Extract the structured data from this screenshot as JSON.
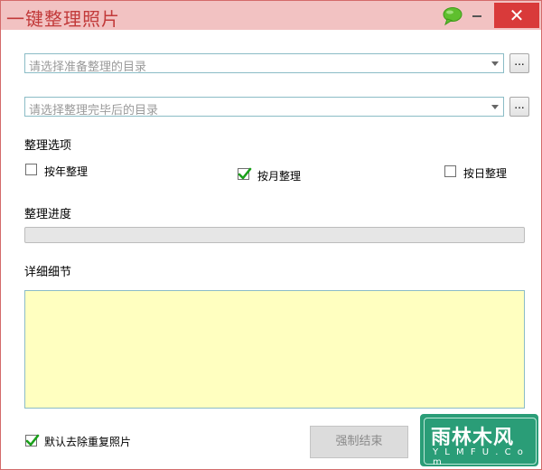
{
  "window": {
    "title": "一键整理照片",
    "close_glyph": "✕"
  },
  "icons": {
    "chat": "chat-bubble-icon",
    "minimize": "minimize-icon",
    "close": "close-icon",
    "dropdown_arrow": "chevron-down-icon",
    "check": "checkmark-icon"
  },
  "source_dir": {
    "placeholder": "请选择准备整理的目录",
    "browse_label": "..."
  },
  "target_dir": {
    "placeholder": "请选择整理完毕后的目录",
    "browse_label": "..."
  },
  "options": {
    "heading": "整理选项",
    "items": [
      {
        "label": "按年整理",
        "checked": false
      },
      {
        "label": "按月整理",
        "checked": true
      },
      {
        "label": "按日整理",
        "checked": false
      }
    ]
  },
  "progress": {
    "heading": "整理进度",
    "value": 0
  },
  "details": {
    "heading": "详细细节",
    "content": ""
  },
  "footer": {
    "dedupe_label": "默认去除重复照片",
    "dedupe_checked": true,
    "stop_button": "强制结束"
  },
  "watermark": {
    "text": "雨林木风",
    "url": "Y L M F U . C o m"
  },
  "colors": {
    "titlebar": "#f2c2c2",
    "close": "#d93a3a",
    "details_bg": "#ffffc0",
    "check": "#1aa01a",
    "watermark": "#2a9d77"
  }
}
